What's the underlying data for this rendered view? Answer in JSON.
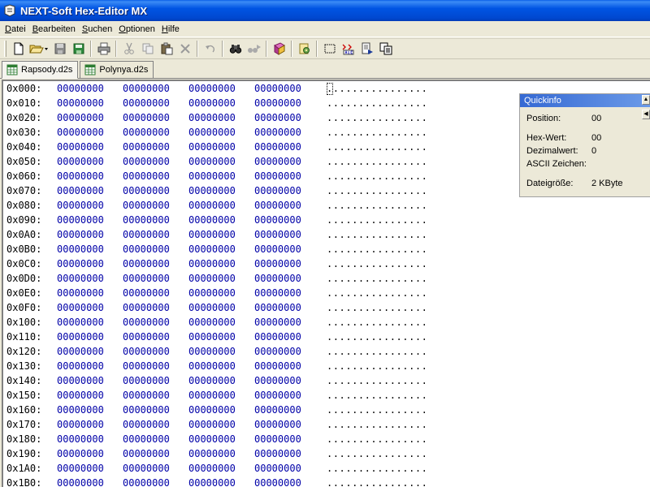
{
  "window": {
    "title": "NEXT-Soft Hex-Editor MX"
  },
  "menu": [
    {
      "underline": "D",
      "rest": "atei"
    },
    {
      "underline": "B",
      "rest": "earbeiten"
    },
    {
      "underline": "S",
      "rest": "uchen"
    },
    {
      "underline": "O",
      "rest": "ptionen"
    },
    {
      "underline": "H",
      "rest": "ilfe"
    }
  ],
  "toolbar_icons": [
    "new-file-icon",
    "open-folder-icon",
    "save-icon",
    "save-all-icon",
    "print-icon",
    "cut-icon",
    "copy-icon",
    "paste-icon",
    "delete-icon",
    "undo-icon",
    "find-icon",
    "find-next-icon",
    "book-icon",
    "settings-icon",
    "select-icon",
    "replace-abc-icon",
    "export-icon",
    "copy-pages-icon"
  ],
  "tabs": [
    {
      "label": "Rapsody.d2s",
      "active": true
    },
    {
      "label": "Polynya.d2s",
      "active": false
    }
  ],
  "hex": {
    "group_value": "00000000",
    "ascii_value": "................",
    "offsets": [
      "0x000:",
      "0x010:",
      "0x020:",
      "0x030:",
      "0x040:",
      "0x050:",
      "0x060:",
      "0x070:",
      "0x080:",
      "0x090:",
      "0x0A0:",
      "0x0B0:",
      "0x0C0:",
      "0x0D0:",
      "0x0E0:",
      "0x0F0:",
      "0x100:",
      "0x110:",
      "0x120:",
      "0x130:",
      "0x140:",
      "0x150:",
      "0x160:",
      "0x170:",
      "0x180:",
      "0x190:",
      "0x1A0:",
      "0x1B0:"
    ]
  },
  "quickinfo": {
    "title": "Quickinfo",
    "position_label": "Position:",
    "position_value": "00",
    "hexwert_label": "Hex-Wert:",
    "hexwert_value": "00",
    "dezimal_label": "Dezimalwert:",
    "dezimal_value": "0",
    "ascii_label": "ASCII Zeichen:",
    "ascii_value": "",
    "size_label": "Dateigröße:",
    "size_value": "2 KByte"
  },
  "colors": {
    "title_bar": "#0054e3",
    "hex_text": "#0000a8",
    "quickinfo_header": "#3569d3"
  }
}
